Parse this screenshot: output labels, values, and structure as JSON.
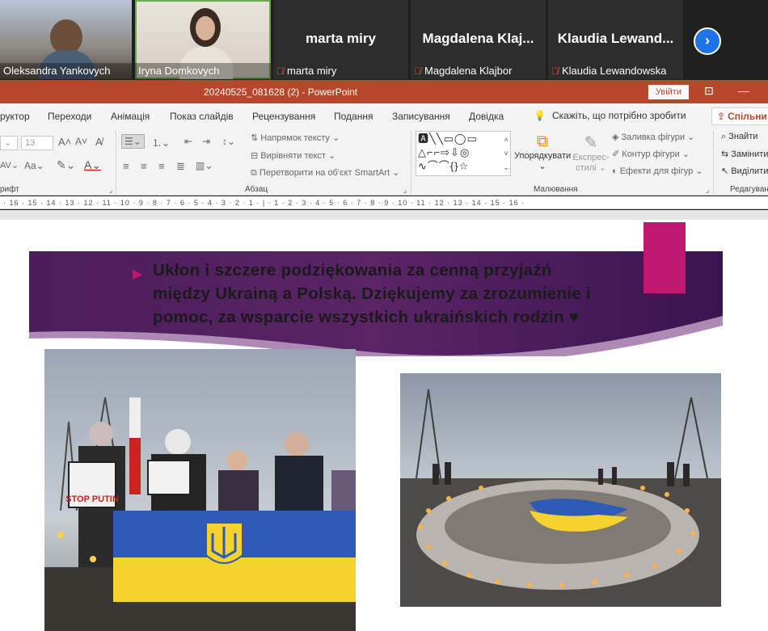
{
  "meeting": {
    "participants": [
      {
        "name": "Oleksandra Yankovych",
        "video": true,
        "muted": false
      },
      {
        "name": "Iryna Domkovych",
        "video": true,
        "muted": false,
        "active": true
      },
      {
        "name": "marta miry",
        "display": "marta miry",
        "video": false,
        "muted": true
      },
      {
        "name": "Magdalena Klajbor",
        "display": "Magdalena  Klaj...",
        "video": false,
        "muted": true
      },
      {
        "name": "Klaudia Lewandowska",
        "display": "Klaudia  Lewand...",
        "video": false,
        "muted": true
      }
    ],
    "next_icon": "chevron-right-icon"
  },
  "powerpoint": {
    "window_title": "20240525_081628 (2)  -  PowerPoint",
    "sign_in": "Увійти",
    "tabs": [
      "руктор",
      "Переходи",
      "Анімація",
      "Показ слайдів",
      "Рецензування",
      "Подання",
      "Записування",
      "Довідка"
    ],
    "tell_me": "Скажіть, що потрібно зробити",
    "share": "Спільни",
    "ribbon": {
      "font_size": "13",
      "font_group": "рифт",
      "paragraph_group": "Абзац",
      "text_direction": "Напрямок тексту",
      "align_text": "Вирівняти текст",
      "convert_smartart": "Перетворити на об'єкт SmartArt",
      "arrange": "Упорядкувати",
      "quick_styles_1": "Експрес-",
      "quick_styles_2": "стилі",
      "shape_fill": "Заливка фігури",
      "shape_outline": "Контур фігури",
      "shape_effects": "Ефекти для фігур",
      "drawing_group": "Малювання",
      "find": "Знайти",
      "replace": "Замінити",
      "select": "Виділити",
      "editing_group": "Редагування"
    },
    "ruler_text": "· 16 · 15 · 14 · 13 · 12 · 11 · 10 · 9 · 8 · 7 · 6 · 5 · 4 · 3 · 2 · 1 · | · 1 · 2 · 3 · 4 · 5 · 6 · 7 · 8 · 9 · 10 · 11 · 12 · 13 · 14 · 15 · 16 ·"
  },
  "slide": {
    "message": "Ukłon i szczere podziękowania za cenną przyjaźń między Ukrainą a Polską. Dziękujemy za zrozumienie i pomoc, za wsparcie wszystkich ukraińskich rodzin ♥",
    "poster_text": "STOP PUTIN",
    "colors": {
      "accent": "#c01772",
      "banner": "#5a2466",
      "flag_blue": "#2d5bb5",
      "flag_yellow": "#f5d22e"
    }
  }
}
